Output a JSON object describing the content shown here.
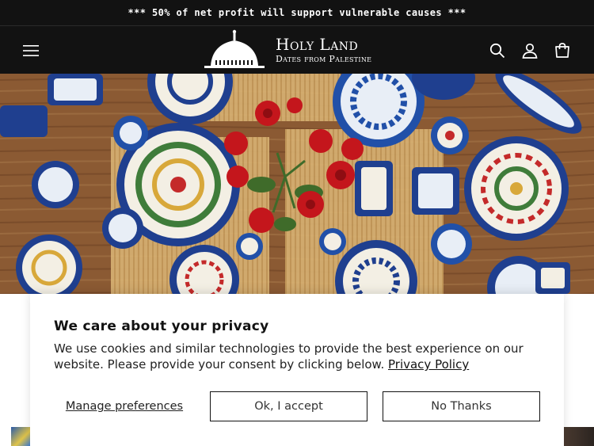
{
  "announcement": {
    "text": "*** 50% of net profit will support vulnerable causes ***"
  },
  "header": {
    "logo_title": "Holy Land",
    "logo_subtitle": "Dates from Palestine",
    "icons": [
      "menu-icon",
      "search-icon",
      "account-icon",
      "cart-icon"
    ]
  },
  "hero": {
    "image": "blue Palestinian ceramic plates with red roses"
  },
  "cookie_banner": {
    "title": "We care about your privacy",
    "body": "We use cookies and similar technologies to provide the best experience on our website. Please provide your consent by clicking below.",
    "policy_link": "Privacy Policy",
    "manage_label": "Manage preferences",
    "accept_label": "Ok, I accept",
    "decline_label": "No Thanks"
  },
  "colors": {
    "header_bg": "#121212",
    "text": "#121212",
    "banner_bg": "#ffffff"
  }
}
